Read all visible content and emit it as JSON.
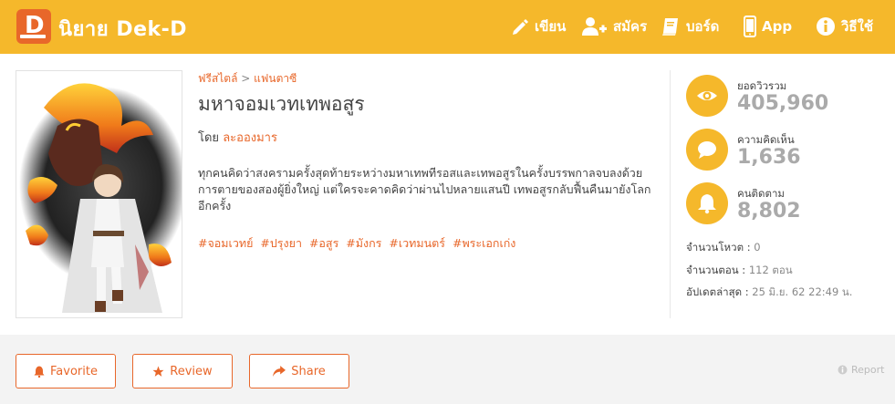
{
  "header": {
    "logo_letter": "D",
    "site_name": "นิยาย Dek-D",
    "nav": [
      {
        "label": "เขียน",
        "icon": "pencil-icon"
      },
      {
        "label": "สมัคร",
        "icon": "add-user-icon"
      },
      {
        "label": "บอร์ด",
        "icon": "book-icon"
      },
      {
        "label": "App",
        "icon": "mobile-icon"
      },
      {
        "label": "วิธีใช้",
        "icon": "info-icon"
      }
    ]
  },
  "novel": {
    "breadcrumb": {
      "first": "ฟรีสไตล์",
      "separator": ">",
      "second": "แฟนตาซี"
    },
    "title": "มหาจอมเวทเทพอสูร",
    "author_prefix": "โดย",
    "author": "ละอองมาร",
    "description": "ทุกคนคิดว่าสงครามครั้งสุดท้ายระหว่างมหาเทพทีรอสและเทพอสูรในครั้งบรรพกาลจบลงด้วยการตายของสองผู้ยิ่งใหญ่ แต่ใครจะคาดคิดว่าผ่านไปหลายแสนปี เทพอสูรกลับฟื้นคืนมายังโลกอีกครั้ง",
    "tags": [
      "#จอมเวทย์",
      "#ปรุงยา",
      "#อสูร",
      "#มังกร",
      "#เวทมนตร์",
      "#พระเอกเก่ง"
    ]
  },
  "stats": [
    {
      "label": "ยอดวิวรวม",
      "value": "405,960",
      "icon": "eye-icon"
    },
    {
      "label": "ความคิดเห็น",
      "value": "1,636",
      "icon": "comment-icon"
    },
    {
      "label": "คนติดตาม",
      "value": "8,802",
      "icon": "bell-icon"
    }
  ],
  "info": [
    {
      "label": "จำนวนโหวต :",
      "value": "0"
    },
    {
      "label": "จำนวนตอน :",
      "value": "112 ตอน"
    },
    {
      "label": "อัปเดตล่าสุด :",
      "value": "25 มิ.ย. 62 22:49 น."
    }
  ],
  "actions": {
    "favorite": "Favorite",
    "review": "Review",
    "share": "Share",
    "report": "Report"
  },
  "colors": {
    "accent": "#f5b82b",
    "brand": "#e8672a",
    "muted": "#aaaaaa"
  }
}
